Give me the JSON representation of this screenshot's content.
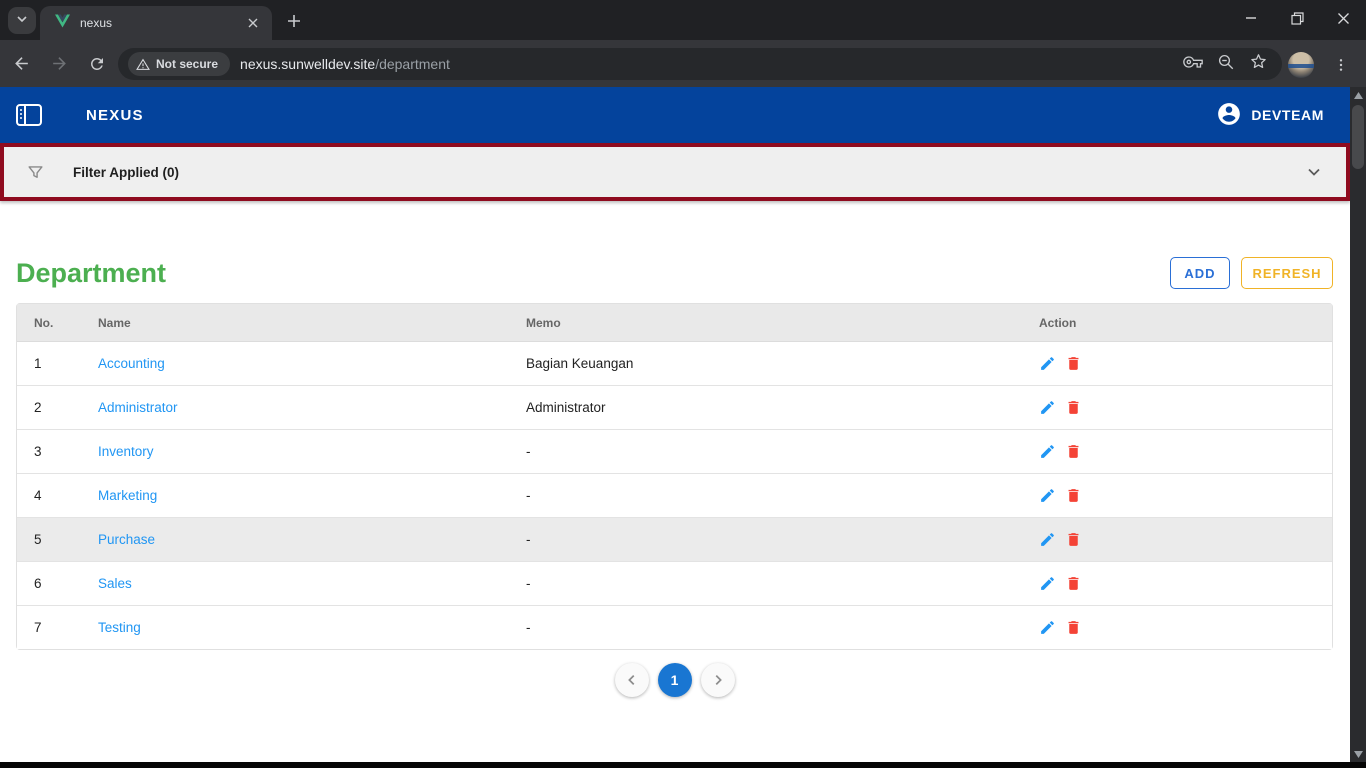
{
  "browser": {
    "tab": {
      "title": "nexus"
    },
    "url": {
      "security_badge": "Not secure",
      "host": "nexus.sunwelldev.site",
      "path": "/department"
    }
  },
  "app_bar": {
    "title": "NEXUS",
    "user": "DEVTEAM"
  },
  "filter_bar": {
    "label": "Filter Applied (0)"
  },
  "page": {
    "title": "Department"
  },
  "actions": {
    "add_label": "ADD",
    "refresh_label": "REFRESH"
  },
  "table": {
    "columns": [
      "No.",
      "Name",
      "Memo",
      "Action"
    ],
    "rows": [
      {
        "no": "1",
        "name": "Accounting",
        "memo": "Bagian Keuangan",
        "highlighted": false
      },
      {
        "no": "2",
        "name": "Administrator",
        "memo": "Administrator",
        "highlighted": false
      },
      {
        "no": "3",
        "name": "Inventory",
        "memo": "-",
        "highlighted": false
      },
      {
        "no": "4",
        "name": "Marketing",
        "memo": "-",
        "highlighted": false
      },
      {
        "no": "5",
        "name": "Purchase",
        "memo": "-",
        "highlighted": true
      },
      {
        "no": "6",
        "name": "Sales",
        "memo": "-",
        "highlighted": false
      },
      {
        "no": "7",
        "name": "Testing",
        "memo": "-",
        "highlighted": false
      }
    ]
  },
  "pagination": {
    "current": "1"
  },
  "colors": {
    "appbar_blue": "#04439c",
    "filter_border_red": "#8f0b1f",
    "title_green": "#4caf50",
    "add_blue": "#2a6fd6",
    "refresh_amber": "#f0b327",
    "link_blue": "#2196f3",
    "edit_blue": "#2196f3",
    "delete_red": "#f44336",
    "pagination_active_blue": "#1976d2"
  }
}
